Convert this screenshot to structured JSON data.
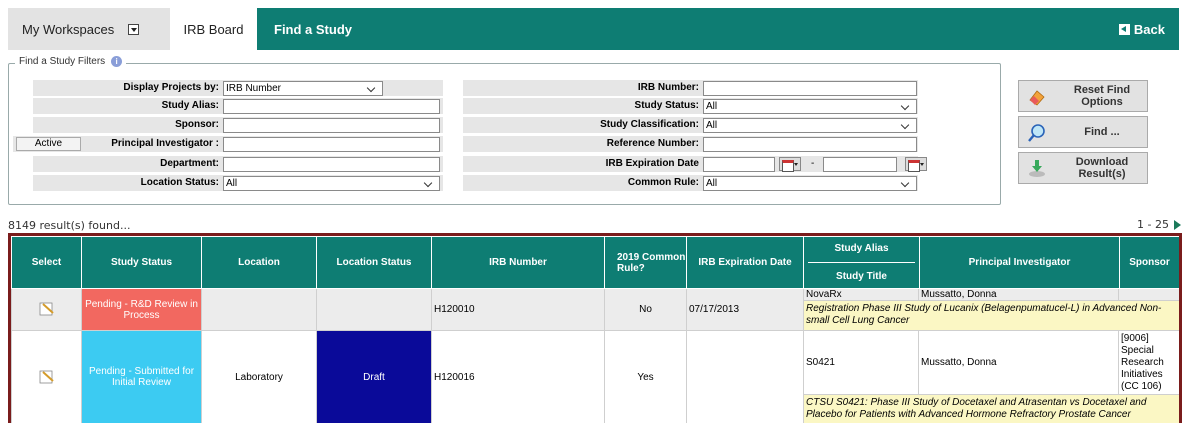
{
  "nav": {
    "workspaces": "My Workspaces",
    "irb_board": "IRB Board",
    "find_study": "Find a Study",
    "back": "Back"
  },
  "filters": {
    "legend": "Find a Study Filters",
    "display_projects_by_label": "Display Projects by:",
    "display_projects_by_value": "IRB Number",
    "study_alias_label": "Study Alias:",
    "sponsor_label": "Sponsor:",
    "active_button": "Active",
    "pi_label": "Principal Investigator :",
    "department_label": "Department:",
    "location_status_label": "Location Status:",
    "location_status_value": "All",
    "irb_number_label": "IRB Number:",
    "study_status_label": "Study Status:",
    "study_status_value": "All",
    "study_classification_label": "Study Classification:",
    "study_classification_value": "All",
    "reference_number_label": "Reference Number:",
    "irb_expiration_label": "IRB Expiration Date",
    "date_separator": "-",
    "common_rule_label": "Common Rule:",
    "common_rule_value": "All"
  },
  "actions": {
    "reset": "Reset Find Options",
    "find": "Find ...",
    "download": "Download Result(s)"
  },
  "results": {
    "count_text": "8149 result(s) found...",
    "page_range": "1 - 25"
  },
  "table": {
    "headers": {
      "select": "Select",
      "study_status": "Study Status",
      "location": "Location",
      "location_status": "Location Status",
      "irb_number": "IRB Number",
      "common_rule": "2019 Common Rule?",
      "irb_expiration": "IRB Expiration Date",
      "study_alias": "Study Alias",
      "study_title": "Study Title",
      "pi": "Principal Investigator",
      "sponsor": "Sponsor"
    },
    "rows": [
      {
        "study_status": "Pending - R&D Review in Process",
        "location": "",
        "location_status": "",
        "irb_number": "H120010",
        "common_rule": "No",
        "irb_expiration": "07/17/2013",
        "study_alias": "NovaRx",
        "pi": "Mussatto, Donna",
        "sponsor": "",
        "study_title": "Registration Phase III Study of Lucanix (Belagenpumatucel-L) in Advanced Non-small Cell Lung Cancer"
      },
      {
        "study_status": "Pending - Submitted for Initial Review",
        "location": "Laboratory",
        "location_status": "Draft",
        "irb_number": "H120016",
        "common_rule": "Yes",
        "irb_expiration": "",
        "study_alias": "S0421",
        "pi": "Mussatto, Donna",
        "sponsor": "[9006] Special Research Initiatives (CC 106)",
        "study_title": "CTSU S0421: Phase III Study of Docetaxel and Atrasentan vs Docetaxel and Placebo for Patients with Advanced Hormone Refractory Prostate Cancer"
      }
    ]
  },
  "colors": {
    "teal": "#0e7d73",
    "pending_red": "#f26860",
    "submitted_blue": "#3ccbf2",
    "draft_navy": "#0a0a99",
    "grid_border": "#7a1c1c"
  }
}
